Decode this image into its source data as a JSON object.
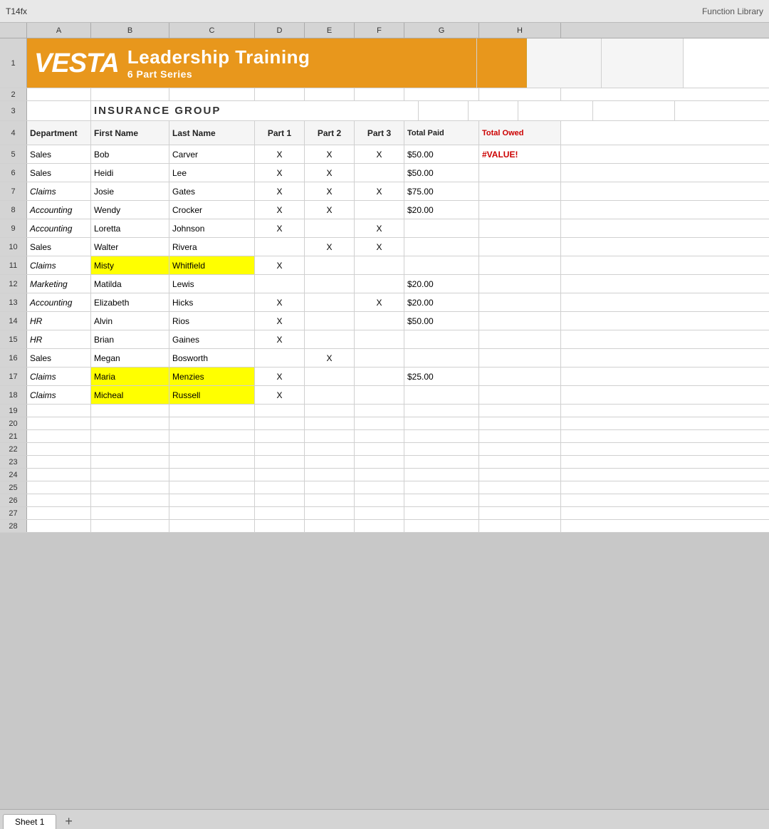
{
  "topbar": {
    "cellRef": "T14",
    "functionLabel": "Function Library",
    "fx": "fx"
  },
  "columns": [
    "A",
    "B",
    "C",
    "D",
    "E",
    "F",
    "G",
    "H"
  ],
  "banner": {
    "vesta": "VESTA",
    "title": "Leadership Training",
    "subtitle": "6 Part Series"
  },
  "insurance": "INSURANCE GROUP",
  "headers": {
    "department": "Department",
    "firstName": "First Name",
    "lastName": "Last Name",
    "part1": "Part 1",
    "part2": "Part 2",
    "part3": "Part 3",
    "totalPaid": "Total Paid",
    "totalOwed": "Total Owed"
  },
  "rows": [
    {
      "row": 5,
      "dept": "Sales",
      "first": "Bob",
      "last": "Carver",
      "p1": "X",
      "p2": "X",
      "p3": "X",
      "paid": "$50.00",
      "owed": "#VALUE!",
      "highlight": false
    },
    {
      "row": 6,
      "dept": "Sales",
      "first": "Heidi",
      "last": "Lee",
      "p1": "X",
      "p2": "X",
      "p3": "",
      "paid": "$50.00",
      "owed": "",
      "highlight": false
    },
    {
      "row": 7,
      "dept": "Claims",
      "first": "Josie",
      "last": "Gates",
      "p1": "X",
      "p2": "X",
      "p3": "X",
      "paid": "$75.00",
      "owed": "",
      "highlight": false
    },
    {
      "row": 8,
      "dept": "Accounting",
      "first": "Wendy",
      "last": "Crocker",
      "p1": "X",
      "p2": "X",
      "p3": "",
      "paid": "$20.00",
      "owed": "",
      "highlight": false
    },
    {
      "row": 9,
      "dept": "Accounting",
      "first": "Loretta",
      "last": "Johnson",
      "p1": "X",
      "p2": "",
      "p3": "X",
      "paid": "",
      "owed": "",
      "highlight": false
    },
    {
      "row": 10,
      "dept": "Sales",
      "first": "Walter",
      "last": "Rivera",
      "p1": "",
      "p2": "X",
      "p3": "X",
      "paid": "",
      "owed": "",
      "highlight": false
    },
    {
      "row": 11,
      "dept": "Claims",
      "first": "Misty",
      "last": "Whitfield",
      "p1": "X",
      "p2": "",
      "p3": "",
      "paid": "",
      "owed": "",
      "highlight": true
    },
    {
      "row": 12,
      "dept": "Marketing",
      "first": "Matilda",
      "last": "Lewis",
      "p1": "",
      "p2": "",
      "p3": "",
      "paid": "$20.00",
      "owed": "",
      "highlight": false
    },
    {
      "row": 13,
      "dept": "Accounting",
      "first": "Elizabeth",
      "last": "Hicks",
      "p1": "X",
      "p2": "",
      "p3": "X",
      "paid": "$20.00",
      "owed": "",
      "highlight": false
    },
    {
      "row": 14,
      "dept": "HR",
      "first": "Alvin",
      "last": "Rios",
      "p1": "X",
      "p2": "",
      "p3": "",
      "paid": "$50.00",
      "owed": "",
      "highlight": false
    },
    {
      "row": 15,
      "dept": "HR",
      "first": "Brian",
      "last": "Gaines",
      "p1": "X",
      "p2": "",
      "p3": "",
      "paid": "",
      "owed": "",
      "highlight": false
    },
    {
      "row": 16,
      "dept": "Sales",
      "first": "Megan",
      "last": "Bosworth",
      "p1": "",
      "p2": "X",
      "p3": "",
      "paid": "",
      "owed": "",
      "highlight": false
    },
    {
      "row": 17,
      "dept": "Claims",
      "first": "Maria",
      "last": "Menzies",
      "p1": "X",
      "p2": "",
      "p3": "",
      "paid": "$25.00",
      "owed": "",
      "highlight": true
    },
    {
      "row": 18,
      "dept": "Claims",
      "first": "Micheal",
      "last": "Russell",
      "p1": "X",
      "p2": "",
      "p3": "",
      "paid": "",
      "owed": "",
      "highlight": true
    }
  ],
  "emptyRows": [
    19,
    20,
    21,
    22,
    23,
    24,
    25,
    26,
    27,
    28
  ],
  "tabs": [
    "Sheet 1"
  ],
  "tabAdd": "+"
}
